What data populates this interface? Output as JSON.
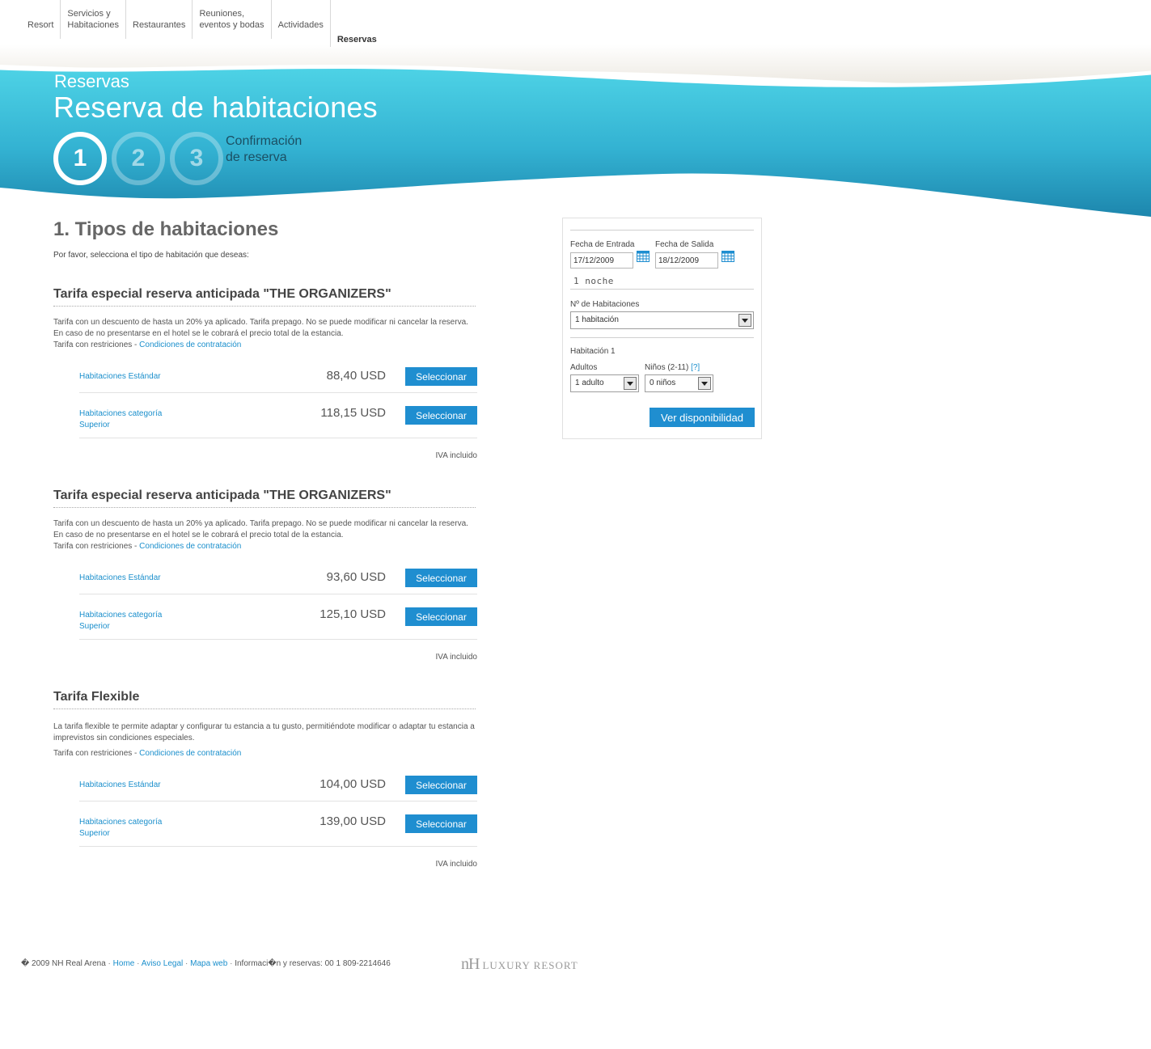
{
  "nav": {
    "items": [
      {
        "label": "Resort"
      },
      {
        "label": "Servicios y\nHabitaciones"
      },
      {
        "label": "Restaurantes"
      },
      {
        "label": "Reuniones,\neventos y bodas"
      },
      {
        "label": "Actividades"
      },
      {
        "label": "Reservas"
      }
    ]
  },
  "header": {
    "subtitle": "Reservas",
    "title": "Reserva de habitaciones",
    "steps": [
      "1",
      "2",
      "3"
    ],
    "step_label_line1": "Confirmación",
    "step_label_line2": "de reserva",
    "colors": {
      "band_top": "#4ed3e6",
      "band_bottom": "#1d86ad"
    }
  },
  "main": {
    "title": "1. Tipos de habitaciones",
    "intro": "Por favor, selecciona el tipo de habitación que deseas:",
    "rates": [
      {
        "title": "Tarifa especial reserva anticipada \"THE ORGANIZERS\"",
        "desc": "Tarifa con un descuento de hasta un 20% ya aplicado. Tarifa prepago. No se puede modificar ni cancelar la reserva. En caso de no presentarse en el hotel se le cobrará el precio total de la estancia.",
        "restr_prefix": "Tarifa con restriciones - ",
        "restr_link": "Condiciones de contratación",
        "rooms": [
          {
            "name": "Habitaciones Estándar",
            "price": "88,40 USD",
            "button": "Seleccionar"
          },
          {
            "name": "Habitaciones categoría Superior",
            "price": "118,15 USD",
            "button": "Seleccionar"
          }
        ],
        "tax_note": "IVA incluido"
      },
      {
        "title": "Tarifa especial reserva anticipada \"THE ORGANIZERS\"",
        "desc": "Tarifa con un descuento de hasta un 20% ya aplicado. Tarifa prepago. No se puede modificar ni cancelar la reserva. En caso de no presentarse en el hotel se le cobrará el precio total de la estancia.",
        "restr_prefix": "Tarifa con restriciones - ",
        "restr_link": "Condiciones de contratación",
        "rooms": [
          {
            "name": "Habitaciones Estándar",
            "price": "93,60 USD",
            "button": "Seleccionar"
          },
          {
            "name": "Habitaciones categoría Superior",
            "price": "125,10 USD",
            "button": "Seleccionar"
          }
        ],
        "tax_note": "IVA incluido"
      },
      {
        "title": "Tarifa Flexible",
        "desc": "La tarifa flexible te permite adaptar y configurar tu estancia a tu gusto, permitiéndote modificar o adaptar tu estancia a imprevistos sin condiciones especiales.",
        "restr_prefix": "Tarifa con restriciones - ",
        "restr_link": "Condiciones de contratación",
        "rooms": [
          {
            "name": "Habitaciones Estándar",
            "price": "104,00 USD",
            "button": "Seleccionar"
          },
          {
            "name": "Habitaciones categoría Superior",
            "price": "139,00 USD",
            "button": "Seleccionar"
          }
        ],
        "tax_note": "IVA incluido"
      }
    ]
  },
  "panel": {
    "checkin_label": "Fecha de Entrada",
    "checkout_label": "Fecha de Salida",
    "checkin_value": "17/12/2009",
    "checkout_value": "18/12/2009",
    "nights": "1 noche",
    "rooms_label": "Nº de Habitaciones",
    "rooms_value": "1 habitación",
    "room1_label": "Habitación 1",
    "adults_label": "Adultos",
    "children_label": "Niños (2-11)",
    "children_help": "[?]",
    "adults_value": "1 adulto",
    "children_value": "0 niños",
    "submit": "Ver disponibilidad",
    "icons": [
      "calendar-icon",
      "calendar-icon"
    ]
  },
  "footer": {
    "copyright": "� 2009 NH Real Arena",
    "home": "Home",
    "legal": "Aviso Legal",
    "sitemap": "Mapa web",
    "info": "Informaci�n y reservas: 00 1 809-2214646",
    "brand_nh": "nH",
    "brand_text": "LUXURY RESORT"
  }
}
